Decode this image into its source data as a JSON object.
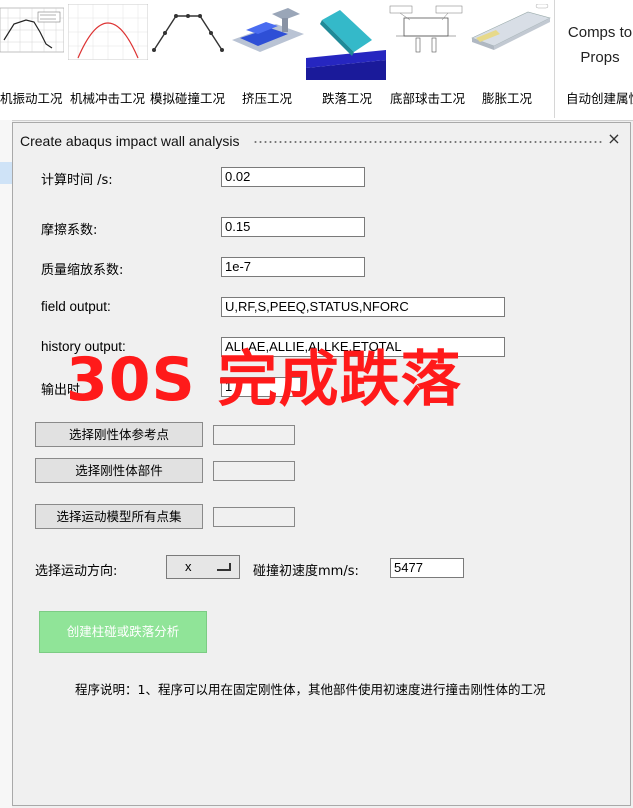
{
  "ribbon": {
    "items": [
      {
        "label": "机振动工况"
      },
      {
        "label": "机械冲击工况"
      },
      {
        "label": "模拟碰撞工况"
      },
      {
        "label": "挤压工况"
      },
      {
        "label": "跌落工况"
      },
      {
        "label": "底部球击工况"
      },
      {
        "label": "膨胀工况"
      }
    ],
    "comps_line1": "Comps to",
    "comps_line2": "Props",
    "auto_label": "自动创建属性"
  },
  "dialog": {
    "title": "Create abaqus impact wall analysis",
    "close": "×",
    "calc_time_label": "计算时间 /s:",
    "calc_time_value": "0.02",
    "friction_label": "摩擦系数:",
    "friction_value": "0.15",
    "mass_scale_label": "质量缩放系数:",
    "mass_scale_value": "1e-7",
    "field_output_label": "field output:",
    "field_output_value": "U,RF,S,PEEQ,STATUS,NFORC",
    "history_output_label": "history output:",
    "history_output_value": "ALLAE,ALLIE,ALLKE,ETOTAL",
    "output_label": "输出时",
    "output_value": "1",
    "btn_ref_point": "选择刚性体参考点",
    "btn_rigid_part": "选择刚性体部件",
    "btn_all_nodes": "选择运动模型所有点集",
    "direction_label": "选择运动方向:",
    "direction_value": "x",
    "velocity_label": "碰撞初速度mm/s:",
    "velocity_value": "5477",
    "create_btn": "创建柱碰或跌落分析",
    "note": "程序说明：1、程序可以用在固定刚性体，其他部件使用初速度进行撞击刚性体的工况"
  },
  "overlay_text": "30S 完成跌落",
  "colors": {
    "overlay": "#ff1a1a",
    "create_button": "#90e498",
    "selection_highlight": "#cfe3f7"
  }
}
